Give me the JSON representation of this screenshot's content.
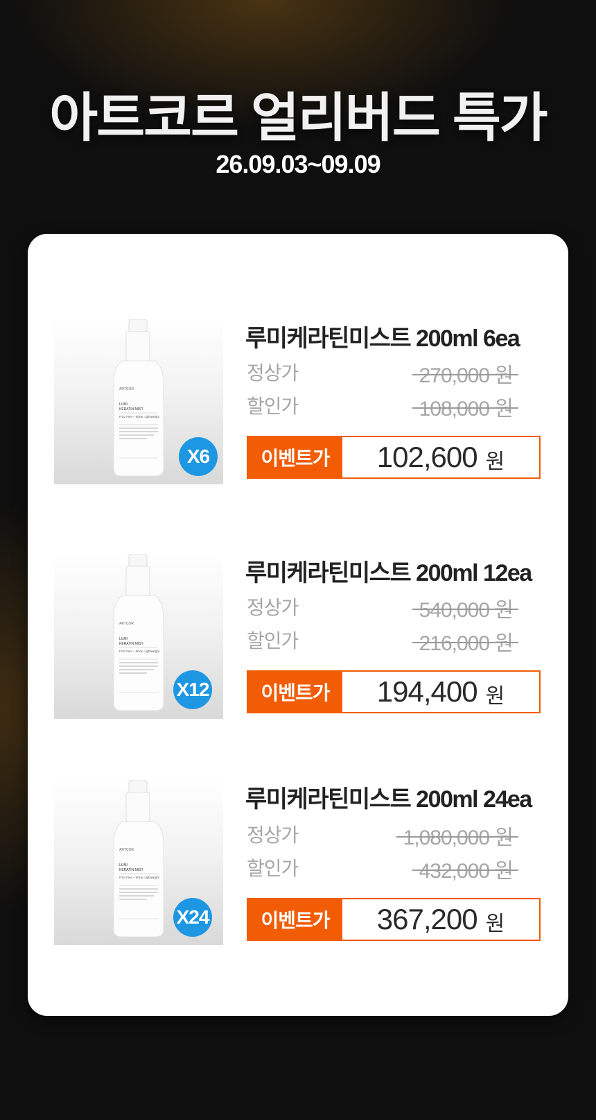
{
  "hero": {
    "title": "아트코르 얼리버드 특가",
    "date_range": "26.09.03~09.09"
  },
  "colors": {
    "accent": "#f25c05",
    "badge": "#1e97e3",
    "background": "#0f0f0f",
    "card": "#ffffff"
  },
  "labels": {
    "regular": "정상가",
    "discount": "할인가",
    "event": "이벤트가"
  },
  "bottle_label": {
    "brand": "ARTCOR",
    "line1": "LUMI",
    "line2": "KERATIN MIST",
    "tagline": "Frizz Free – Shine, Lightweight"
  },
  "products": [
    {
      "name": "루미케라틴미스트 200ml 6ea",
      "qty_badge": "X6",
      "regular_price": "270,000 원",
      "discount_price": "108,000 원",
      "event_price": "102,600",
      "currency": "원"
    },
    {
      "name": "루미케라틴미스트 200ml 12ea",
      "qty_badge": "X12",
      "regular_price": "540,000 원",
      "discount_price": "216,000 원",
      "event_price": "194,400",
      "currency": "원"
    },
    {
      "name": "루미케라틴미스트 200ml 24ea",
      "qty_badge": "X24",
      "regular_price": "1,080,000 원",
      "discount_price": "432,000 원",
      "event_price": "367,200",
      "currency": "원"
    }
  ]
}
